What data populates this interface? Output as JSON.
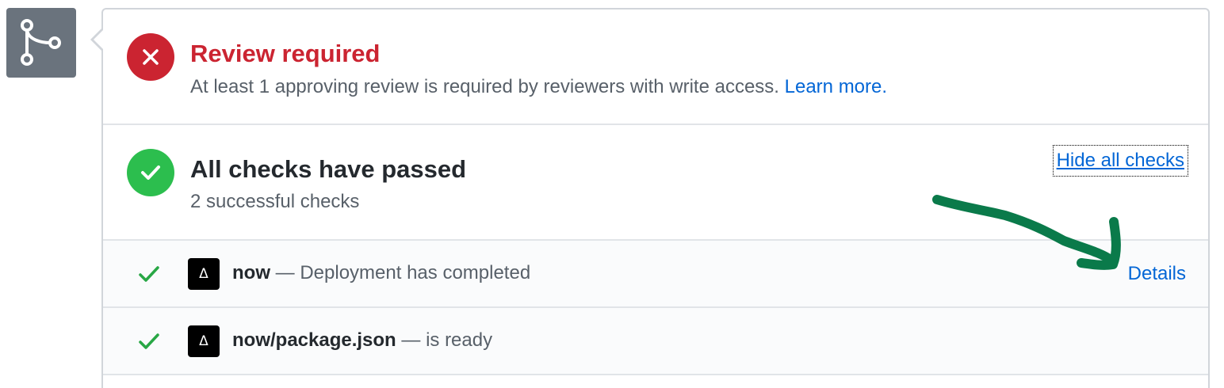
{
  "review": {
    "title": "Review required",
    "description": "At least 1 approving review is required by reviewers with write access.",
    "learn_more_label": "Learn more.",
    "status_icon": "x-icon",
    "status_color": "#cb2431"
  },
  "checks": {
    "title": "All checks have passed",
    "subtitle": "2 successful checks",
    "hide_label": "Hide all checks",
    "status_icon": "check-icon",
    "status_color": "#2cbe4e"
  },
  "check_rows": [
    {
      "name": "now",
      "separator": " — ",
      "status_text": "Deployment has completed",
      "avatar_glyph": "Δ",
      "details_label": "Details"
    },
    {
      "name": "now/package.json",
      "separator": " — ",
      "status_text": "is ready",
      "avatar_glyph": "Δ",
      "details_label": ""
    }
  ],
  "branch_icon": "git-branch-icon",
  "colors": {
    "link": "#0366d6",
    "success": "#2cbe4e",
    "danger": "#cb2431",
    "annotation_arrow": "#0a7a4a"
  }
}
